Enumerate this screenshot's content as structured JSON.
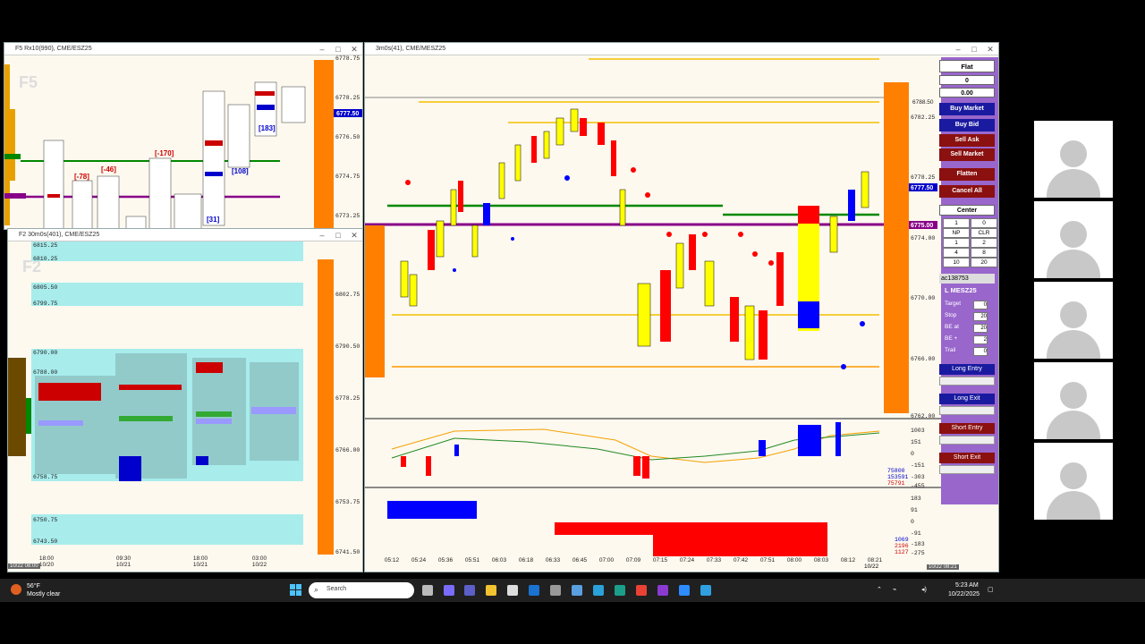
{
  "windows": {
    "f5": {
      "title": "F5 Rx10(990), CME/ESZ25",
      "watermark": "F5",
      "price_flag": "6777.50",
      "y_labels": [
        "6778.75",
        "6778.25",
        "6776.50",
        "6774.75",
        "6773.25"
      ],
      "deltas": [
        "[-170]",
        "[-78]",
        "[-46]",
        "[31]",
        "[108]",
        "[183]"
      ]
    },
    "f2": {
      "title": "F2 30m0s(401), CME/ESZ25",
      "watermark": "F2",
      "levels": [
        "6815.25",
        "6810.25",
        "6805.50",
        "6799.75",
        "6790.00",
        "6788.00",
        "6758.75",
        "6750.75",
        "6743.50"
      ],
      "y_labels": [
        "6802.75",
        "6790.50",
        "6778.25",
        "6766.00",
        "6753.75",
        "6741.50"
      ],
      "x_labels": [
        {
          "t": "18:00",
          "d": "10/20"
        },
        {
          "t": "09:30",
          "d": "10/21"
        },
        {
          "t": "18:00",
          "d": "10/21"
        },
        {
          "t": "03:00",
          "d": "10/22"
        }
      ],
      "corner": "10/22 08:00"
    },
    "main": {
      "title": "3m0s(41), CME/MESZ25",
      "y_labels": [
        "6782.25",
        "6778.25",
        "6774.00",
        "6770.00",
        "6766.00",
        "6762.00"
      ],
      "price_flag": "6777.50",
      "green_flag": "6775.00",
      "top_flag": "6788.50",
      "ind1_labels": [
        "1003",
        "151",
        "0",
        "-151",
        "-303",
        "-455"
      ],
      "ind1_values": [
        "75800",
        "153591",
        "75791"
      ],
      "ind2_labels": [
        "183",
        "91",
        "0",
        "-91",
        "-183",
        "-275"
      ],
      "ind2_values": [
        "1069",
        "2196",
        "1127"
      ],
      "x_labels": [
        "05:12",
        "05:24",
        "05:36",
        "05:51",
        "06:03",
        "06:18",
        "06:33",
        "06:45",
        "07:00",
        "07:09",
        "07:15",
        "07:24",
        "07:33",
        "07:42",
        "07:51",
        "08:00",
        "08:03",
        "08:12",
        "08:21"
      ],
      "x_date": "10/22",
      "corner": "10/22 08:21"
    }
  },
  "order_panel": {
    "position": "Flat",
    "qty": "0",
    "pnl": "0.00",
    "buttons": {
      "buy_market": "Buy Market",
      "buy_bid": "Buy Bid",
      "sell_ask": "Sell Ask",
      "sell_market": "Sell Market",
      "flatten": "Flatten",
      "cancel_all": "Cancel All",
      "center": "Center"
    },
    "qty_grid": [
      [
        "1",
        "0"
      ],
      [
        "NP",
        "CLR"
      ],
      [
        "1",
        "2"
      ],
      [
        "4",
        "8"
      ],
      [
        "10",
        "20"
      ]
    ],
    "account": "ac138753",
    "instrument": "L MESZ25",
    "fields": [
      {
        "label": "Target",
        "value": "0"
      },
      {
        "label": "Stop",
        "value": "20"
      },
      {
        "label": "BE at",
        "value": "20"
      },
      {
        "label": "BE +",
        "value": "2"
      },
      {
        "label": "Trail",
        "value": "0"
      }
    ],
    "strategy": {
      "long_entry": "Long Entry",
      "long_exit": "Long Exit",
      "short_entry": "Short Entry",
      "short_exit": "Short Exit"
    }
  },
  "taskbar": {
    "weather_temp": "56°F",
    "weather_desc": "Mostly clear",
    "search_placeholder": "Search",
    "time": "5:23 AM",
    "date": "10/22/2025"
  },
  "colors": {
    "up": "#ffff00",
    "down": "#ff0000",
    "blue": "#0000ff",
    "green": "#008800",
    "purple": "#880088",
    "orange": "#ff8000",
    "panel": "#9966cc",
    "button": "#1a1aa0",
    "sell": "#8b1010"
  }
}
